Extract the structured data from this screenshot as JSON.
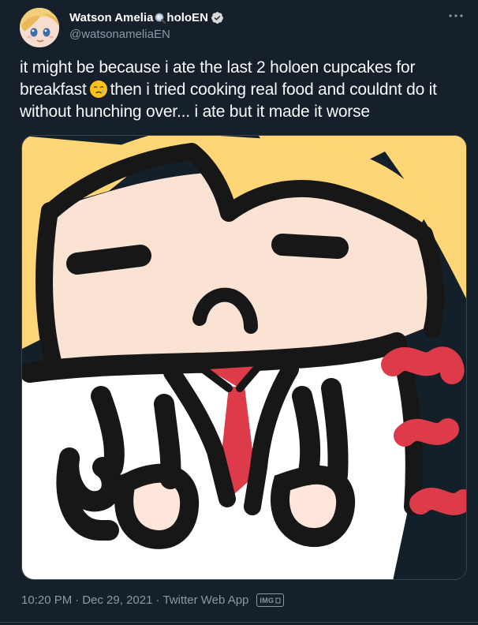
{
  "author": {
    "display_name": "Watson Amelia",
    "name_emoji": "magnifying-glass-emoji",
    "name_suffix": "holoEN",
    "verified": true,
    "handle": "@watsonameliaEN"
  },
  "tweet": {
    "text_before_emoji": "it might be because i ate the last 2 holoen cupcakes for breakfast",
    "inline_emoji": "face-holding-back-tears-emoji",
    "text_after_emoji": "then i tried cooking real food and couldnt do it without hunching over... i ate but it made it worse"
  },
  "media": {
    "type": "image",
    "depicts": "drawing-of-blonde-girl-hunched-over"
  },
  "meta": {
    "time": "10:20 PM",
    "date": "Dec 29, 2021",
    "separator": "·",
    "source": "Twitter Web App",
    "badge": "IMG"
  },
  "colors": {
    "background": "#15202b",
    "text": "#f7f9f9",
    "secondary_text": "#8b98a5",
    "verified_badge": "#d9d9d9",
    "border": "#38444d"
  }
}
